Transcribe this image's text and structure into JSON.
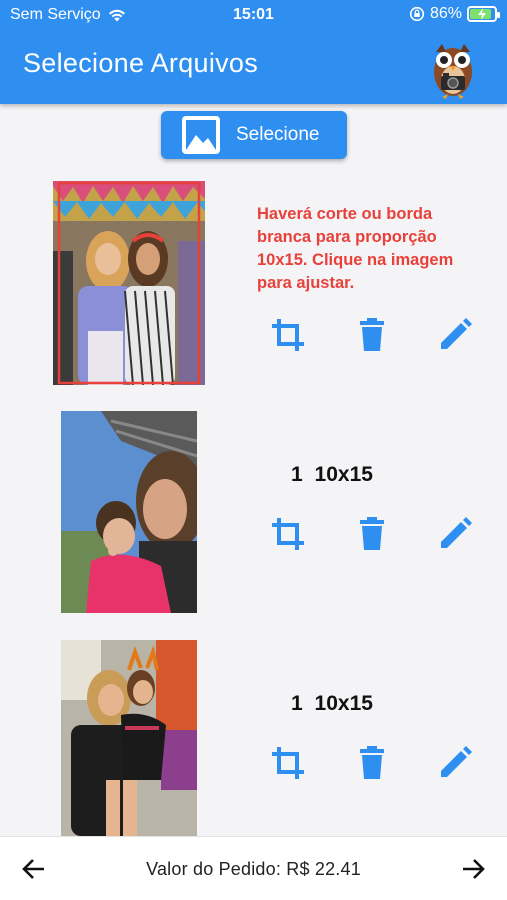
{
  "status_bar": {
    "carrier": "Sem Serviço",
    "time": "15:01",
    "battery": "86%",
    "battery_level": 0.86
  },
  "app_bar": {
    "title": "Selecione Arquivos",
    "logo_icon": "owl-camera-mascot"
  },
  "select_button": {
    "label": "Selecione",
    "icon": "image-icon"
  },
  "photos": [
    {
      "warning": "Haverá corte ou borda branca para proporção 10x15. Clique na imagem para ajustar.",
      "actions": [
        "crop-icon",
        "delete-icon",
        "edit-icon"
      ]
    },
    {
      "quantity": "1",
      "size": "10x15",
      "actions": [
        "crop-icon",
        "delete-icon",
        "edit-icon"
      ]
    },
    {
      "quantity": "1",
      "size": "10x15",
      "actions": [
        "crop-icon",
        "delete-icon",
        "edit-icon"
      ]
    }
  ],
  "footer": {
    "total_label": "Valor do Pedido: R$ 22.41",
    "back_icon": "arrow-left-icon",
    "next_icon": "arrow-right-icon"
  },
  "colors": {
    "primary": "#2f8ff0",
    "warning": "#e8413b",
    "background": "#f4f4f6"
  }
}
